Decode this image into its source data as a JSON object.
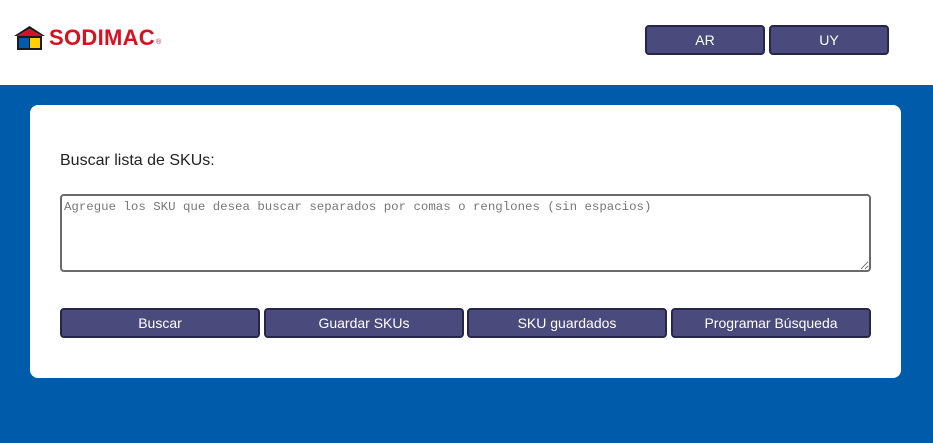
{
  "brand": {
    "name": "SODIMAC",
    "registered_mark": "®",
    "colors": {
      "red": "#d7121f",
      "blue": "#005baa",
      "yellow": "#ffd100"
    }
  },
  "header": {
    "country_buttons": [
      {
        "label": "AR"
      },
      {
        "label": "UY"
      }
    ]
  },
  "search": {
    "title": "Buscar lista de SKUs:",
    "placeholder": "Agregue los SKU que desea buscar separados por comas o renglones (sin espacios)",
    "value": ""
  },
  "actions": [
    {
      "label": "Buscar"
    },
    {
      "label": "Guardar SKUs"
    },
    {
      "label": "SKU guardados"
    },
    {
      "label": "Programar Búsqueda"
    }
  ],
  "theme": {
    "button_bg": "#4a4a7c",
    "button_border": "#26264a",
    "page_bg": "#005baa"
  }
}
